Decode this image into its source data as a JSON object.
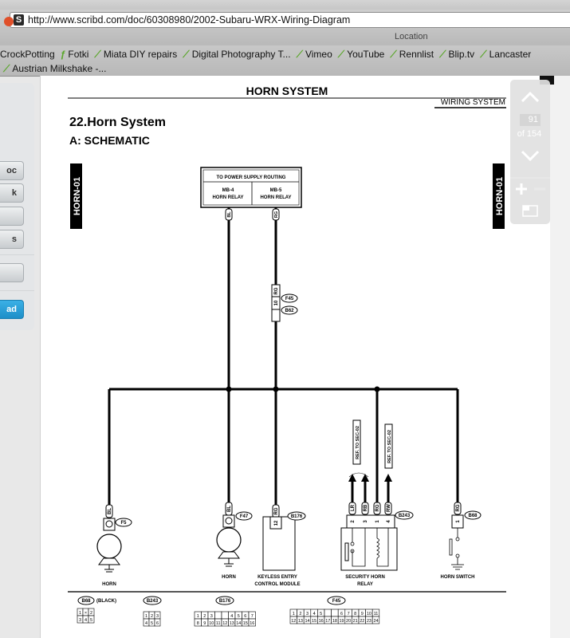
{
  "browser": {
    "url": "http://www.scribd.com/doc/60308980/2002-Subaru-WRX-Wiring-Diagram",
    "favicon": "S",
    "location_label": "Location",
    "bookmarks_row1": [
      "CrockPotting",
      "Fotki",
      "Miata DIY repairs",
      "Digital Photography T...",
      "Vimeo",
      "YouTube",
      "Rennlist",
      "Blip.tv",
      "Lancaster"
    ],
    "bookmarks_row2": [
      "Austrian Milkshake -..."
    ]
  },
  "sidebar": {
    "buttons": [
      "oc",
      "k",
      "",
      "s",
      ""
    ],
    "download_label": "ad"
  },
  "viewer": {
    "page_number": "91",
    "page_total": "of 154"
  },
  "document": {
    "header": "HORN SYSTEM",
    "section": "WIRING SYSTEM",
    "title": "22.Horn System",
    "subtitle": "A:  SCHEMATIC",
    "tab_label": "HORN-01",
    "power_box": {
      "top": "TO POWER SUPPLY ROUTING",
      "left1": "MB-4",
      "left2": "HORN RELAY",
      "right1": "MB-5",
      "right2": "HORN RELAY"
    },
    "wire_colors": {
      "bl": "BL",
      "rg": "RG",
      "lr": "LR",
      "rb": "RB",
      "rw": "RW"
    },
    "connectors": {
      "f45": "F45",
      "b62": "B62",
      "f5": "F5",
      "f47": "F47",
      "b176": "B176",
      "b243": "B243",
      "b68": "B68",
      "pin10": "10",
      "pin12": "12",
      "pin2": "2",
      "pin3": "3",
      "pin1": "1",
      "pin4": "4"
    },
    "refs": [
      "REF. TO SEC-02",
      "REF. TO SEC-02"
    ],
    "labels": {
      "horn1": "HORN",
      "horn2": "HORN",
      "keyless1": "KEYLESS ENTRY",
      "keyless2": "CONTROL MODULE",
      "relay1": "SECURITY HORN",
      "relay2": "RELAY",
      "switch": "HORN SWITCH"
    },
    "legend": {
      "b68": "B68",
      "b68_note": "(BLACK)",
      "b243": "B243",
      "b176": "B176",
      "f45": "F45"
    }
  }
}
